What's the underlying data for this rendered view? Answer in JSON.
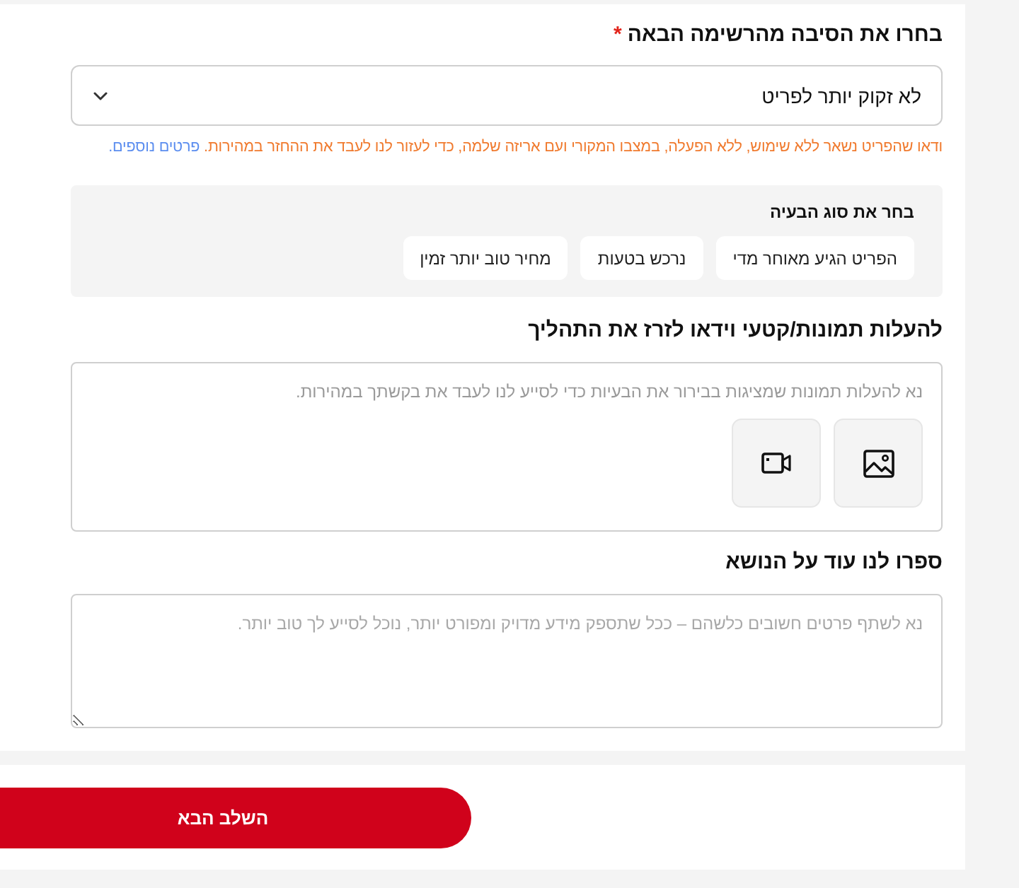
{
  "reason_section": {
    "title": "בחרו את הסיבה מהרשימה הבאה",
    "required_mark": "*",
    "select": {
      "value": "לא זקוק יותר לפריט"
    },
    "note": {
      "text": "ודאו שהפריט נשאר ללא שימוש, ללא הפעלה, במצבו המקורי ועם אריזה שלמה, כדי לעזור לנו לעבד את ההחזר במהירות.",
      "link": "פרטים נוספים."
    }
  },
  "issue_type": {
    "title": "בחר את סוג הבעיה",
    "options": [
      {
        "label": "הפריט הגיע מאוחר מדי",
        "selected": false
      },
      {
        "label": "נרכש בטעות",
        "selected": false
      },
      {
        "label": "מחיר טוב יותר זמין",
        "selected": false
      }
    ]
  },
  "upload": {
    "title": "להעלות תמונות/קטעי וידאו לזרז את התהליך",
    "hint": "נא להעלות תמונות שמציגות בבירור את הבעיות כדי לסייע לנו לעבד את בקשתך במהירות.",
    "buttons": [
      {
        "kind": "image"
      },
      {
        "kind": "video"
      }
    ]
  },
  "details": {
    "title": "ספרו לנו עוד על הנושא",
    "placeholder": "נא לשתף פרטים חשובים כלשהם – ככל שתספק מידע מדויק ומפורט יותר, נוכל לסייע לך טוב יותר."
  },
  "next_button": {
    "label": "השלב הבא"
  }
}
